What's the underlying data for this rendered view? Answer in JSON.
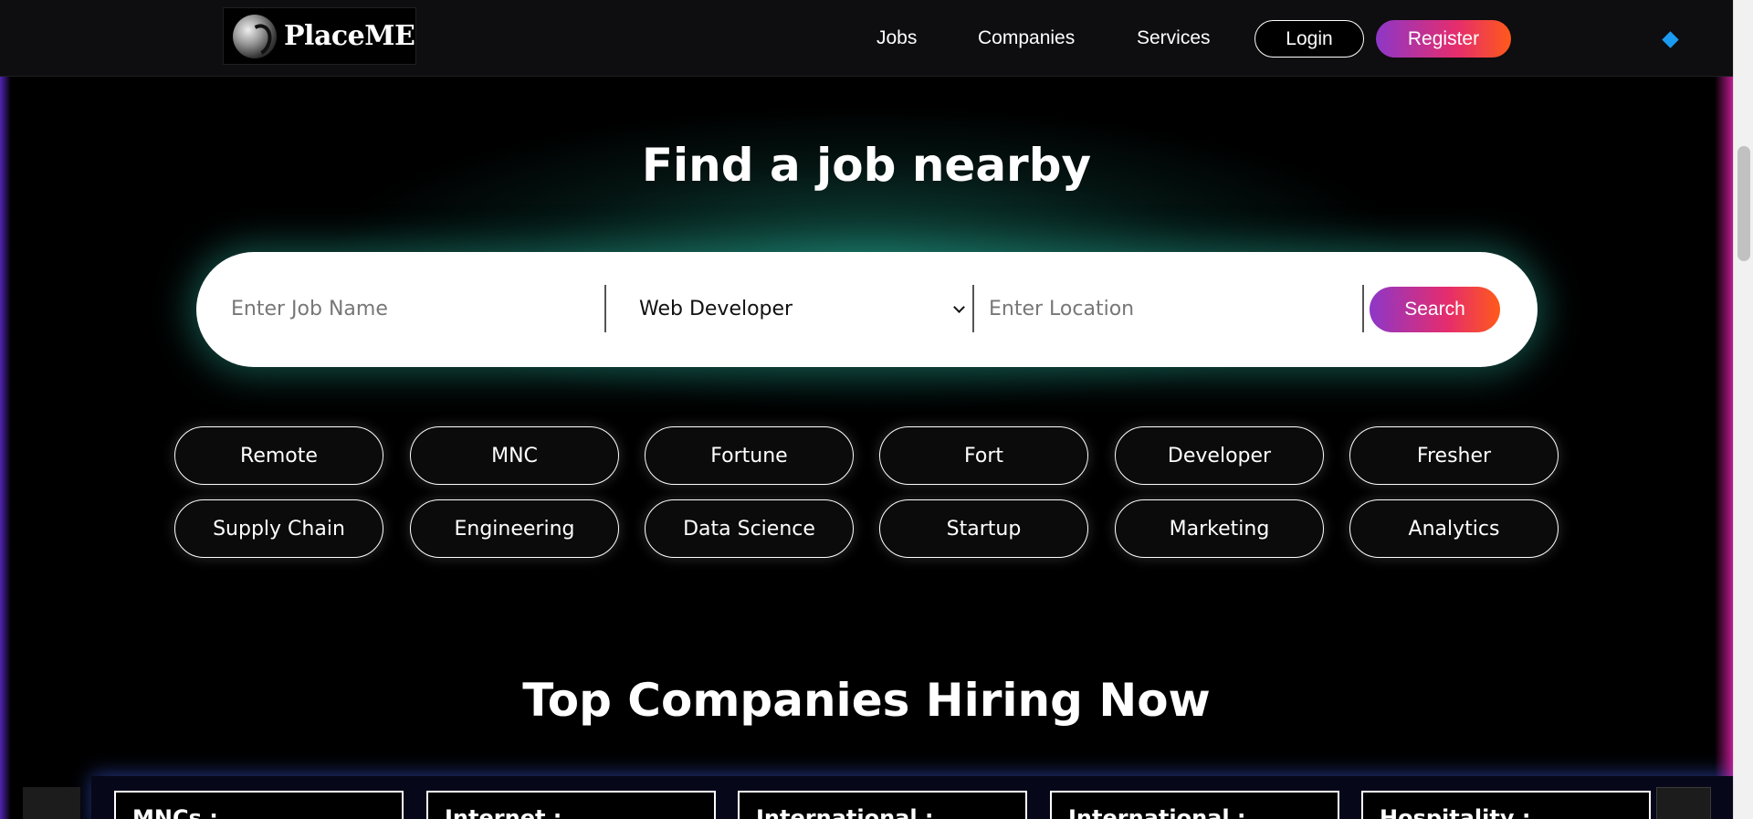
{
  "brand": {
    "name": "PlaceME"
  },
  "nav": {
    "links": [
      "Jobs",
      "Companies",
      "Services"
    ],
    "login_label": "Login",
    "register_label": "Register"
  },
  "hero": {
    "title": "Find a job nearby"
  },
  "search": {
    "job_placeholder": "Enter Job Name",
    "category_selected": "Web Developer",
    "location_placeholder": "Enter Location",
    "search_label": "Search"
  },
  "tags": [
    "Remote",
    "MNC",
    "Fortune",
    "Fort",
    "Developer",
    "Fresher",
    "Supply Chain",
    "Engineering",
    "Data Science",
    "Startup",
    "Marketing",
    "Analytics"
  ],
  "companies": {
    "title": "Top Companies Hiring Now",
    "cards": [
      "MNCs :",
      "Internet :",
      "International :",
      "International :",
      "Hospitality :"
    ]
  },
  "colors": {
    "accent_gradient_start": "#8d37c8",
    "accent_gradient_end": "#ff5a1a",
    "glow": "#1e8c78",
    "diamond": "#1a9bf0"
  }
}
